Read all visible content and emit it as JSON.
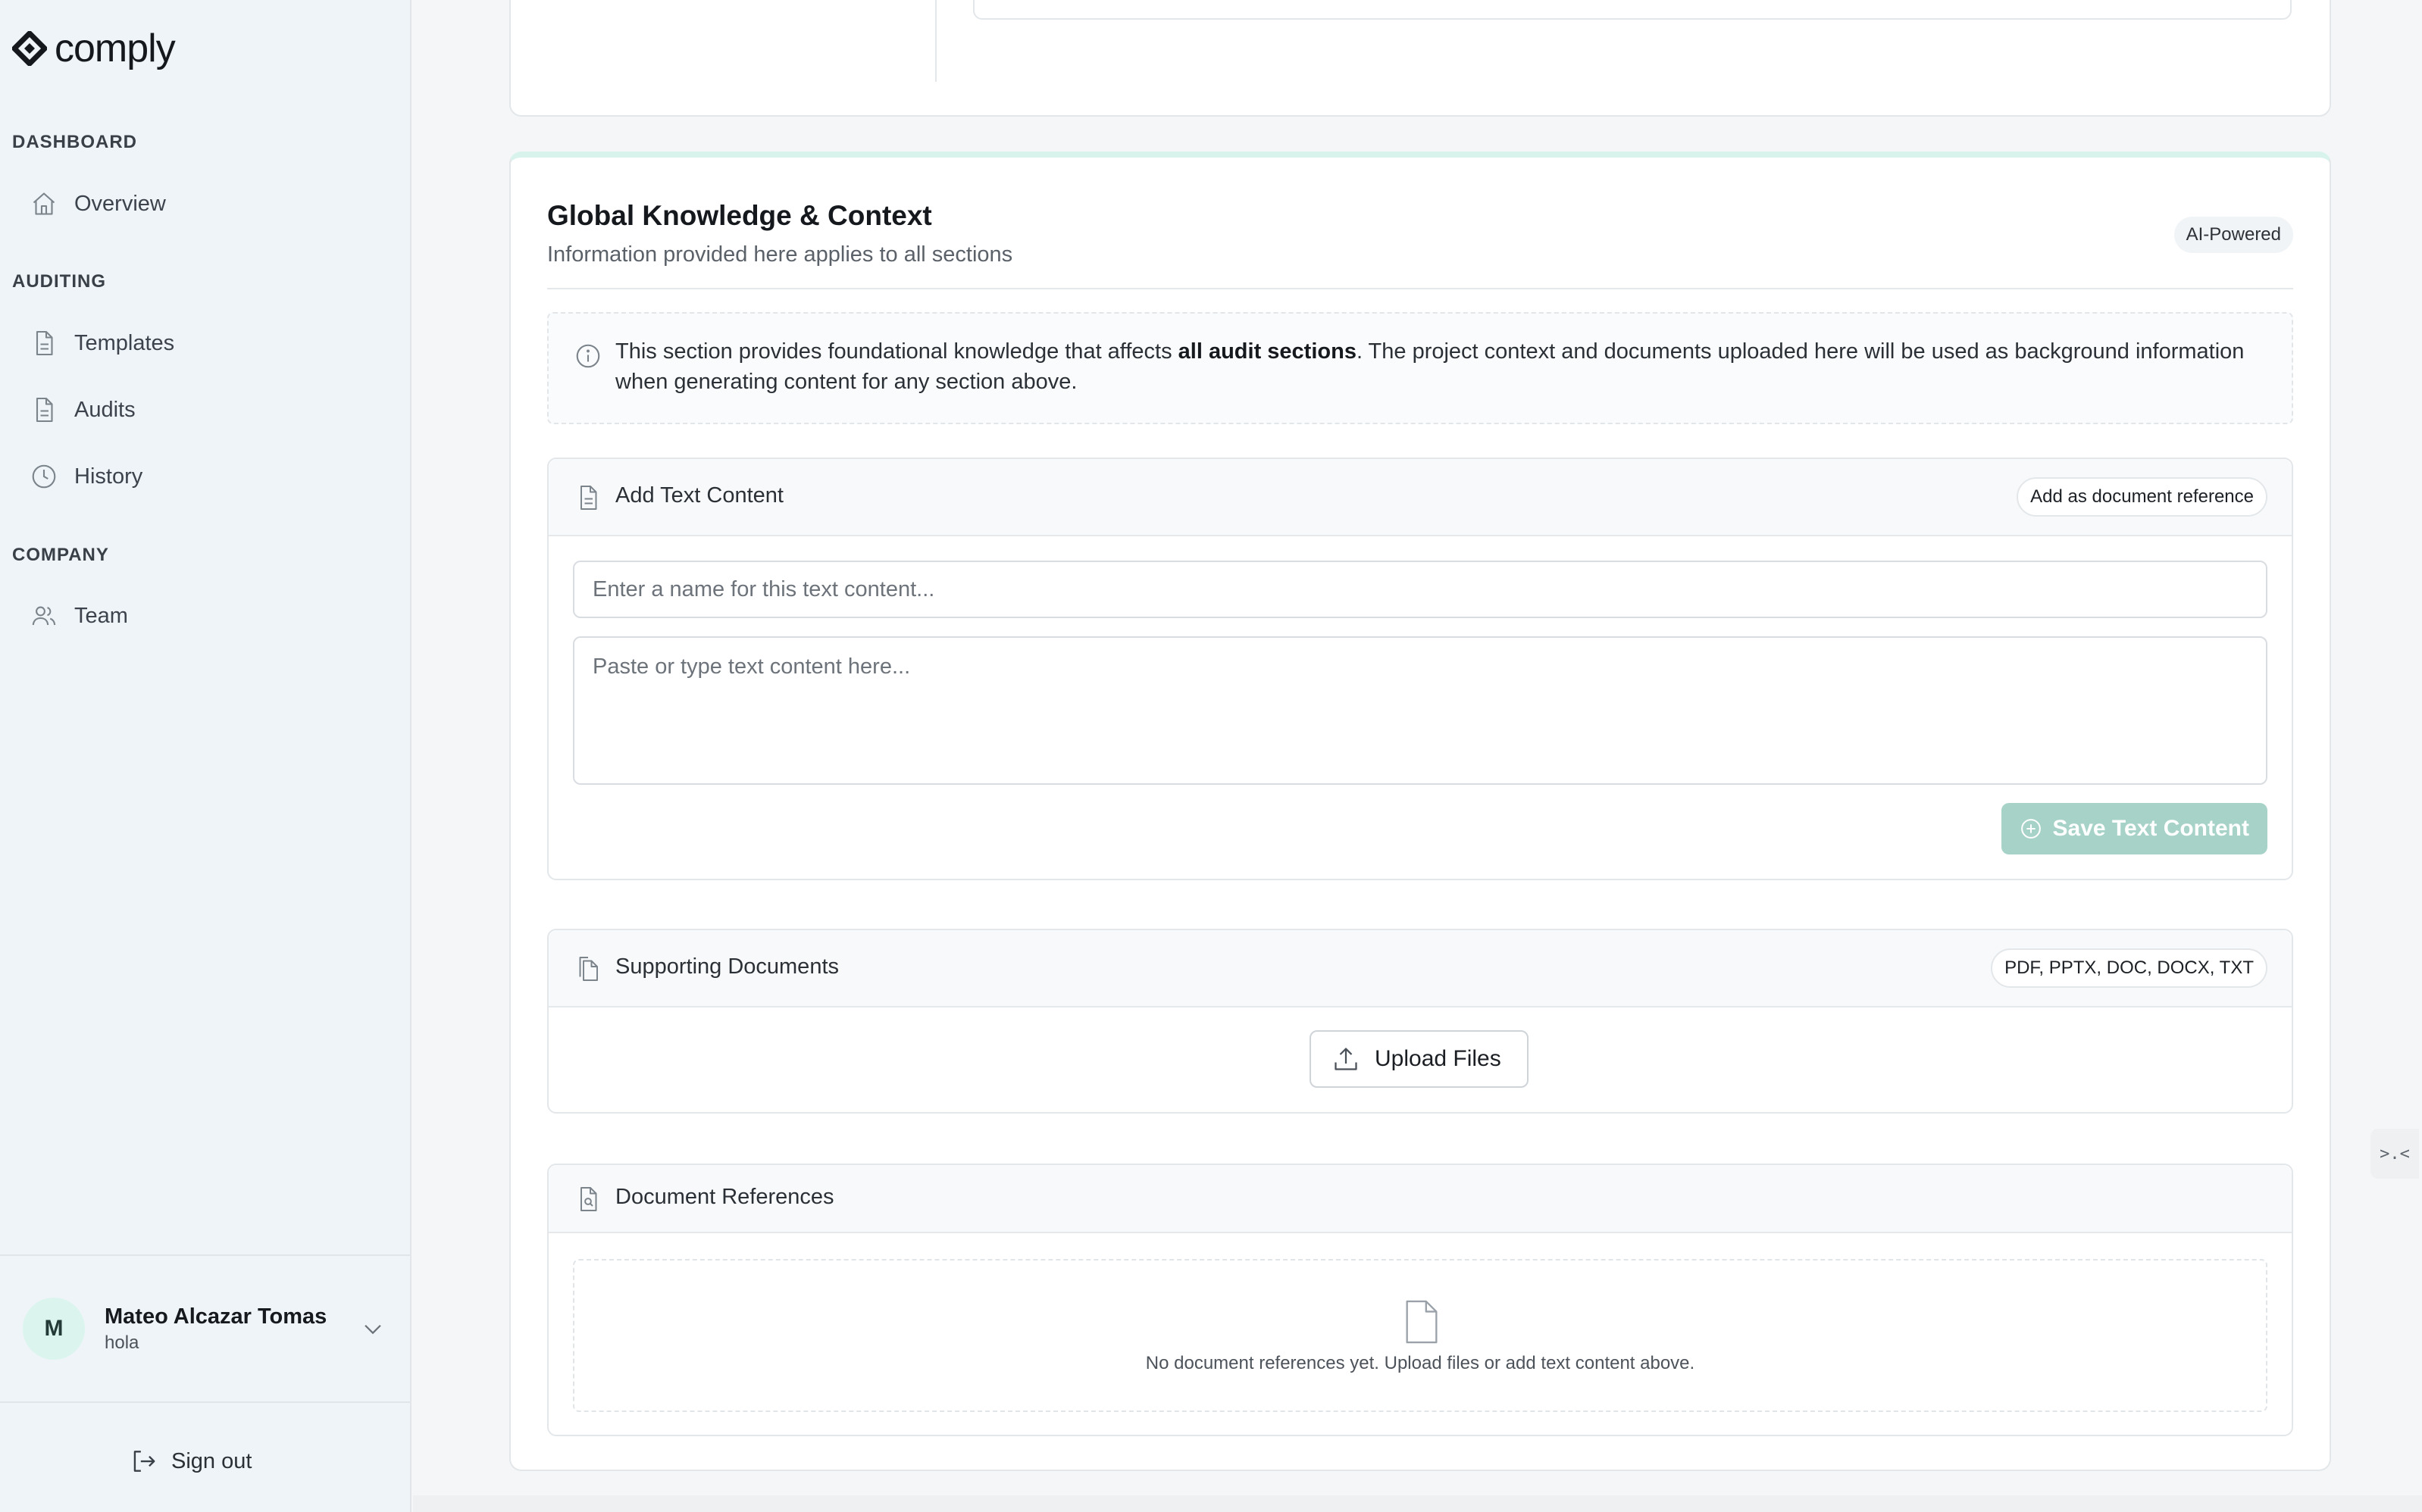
{
  "app": {
    "brand": "comply"
  },
  "sidebar": {
    "sections": [
      {
        "heading": "DASHBOARD",
        "items": [
          {
            "label": "Overview",
            "icon": "home-icon"
          }
        ]
      },
      {
        "heading": "AUDITING",
        "items": [
          {
            "label": "Templates",
            "icon": "file-icon"
          },
          {
            "label": "Audits",
            "icon": "file-icon"
          },
          {
            "label": "History",
            "icon": "clock-icon"
          }
        ]
      },
      {
        "heading": "COMPANY",
        "items": [
          {
            "label": "Team",
            "icon": "users-icon"
          }
        ]
      }
    ],
    "user": {
      "initial": "M",
      "name": "Mateo Alcazar Tomas",
      "org": "hola"
    },
    "signout_label": "Sign out"
  },
  "knowledge": {
    "title": "Global Knowledge & Context",
    "subtitle": "Information provided here applies to all sections",
    "badge": "AI-Powered",
    "info_prefix": "This section provides foundational knowledge that affects ",
    "info_bold": "all audit sections",
    "info_suffix": ". The project context and documents uploaded here will be used as background information when generating content for any section above.",
    "text_content": {
      "title": "Add Text Content",
      "toggle_label": "Add as document reference",
      "name_placeholder": "Enter a name for this text content...",
      "body_placeholder": "Paste or type text content here...",
      "save_label": "Save Text Content"
    },
    "supporting_docs": {
      "title": "Supporting Documents",
      "formats": "PDF, PPTX, DOC, DOCX, TXT",
      "upload_label": "Upload Files"
    },
    "references": {
      "title": "Document References",
      "empty_text": "No document references yet. Upload files or add text content above."
    }
  },
  "colors": {
    "accent": "#a7d2c7",
    "accent_light": "#d8f3ec",
    "sidebar_bg": "#eef4f7"
  },
  "collapse_handle": ">.<"
}
